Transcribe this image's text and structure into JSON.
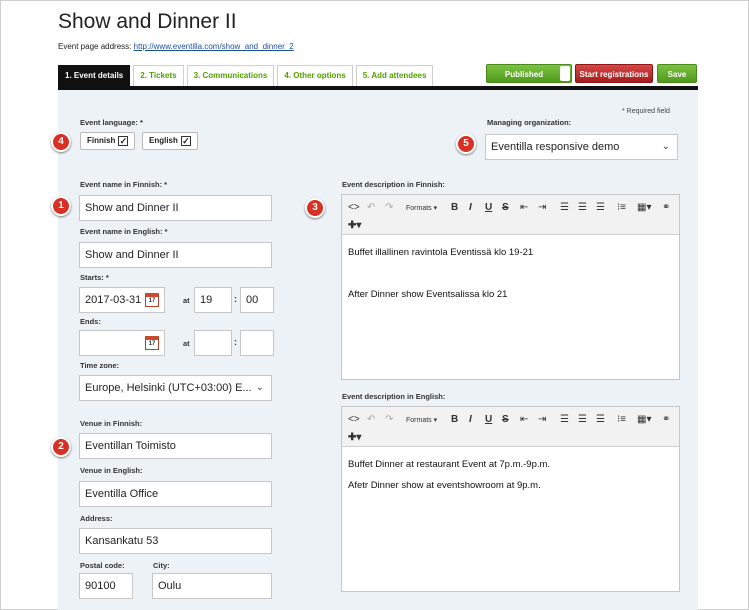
{
  "page": {
    "title": "Show and Dinner II",
    "address_label": "Event page address:",
    "address_url": "http://www.eventilla.com/show_and_dinner_2"
  },
  "tabs": [
    "1. Event details",
    "2. Tickets",
    "3. Communications",
    "4. Other options",
    "5. Add attendees"
  ],
  "actions": {
    "published": "Published",
    "start_registrations": "Start registrations",
    "save": "Save"
  },
  "required_note": "* Required field",
  "language": {
    "label": "Event language: *",
    "options": [
      {
        "label": "Finnish",
        "checked": true
      },
      {
        "label": "English",
        "checked": true
      }
    ]
  },
  "organization": {
    "label": "Managing organization:",
    "value": "Eventilla responsive demo"
  },
  "name_fi": {
    "label": "Event name in Finnish: *",
    "value": "Show and Dinner II"
  },
  "name_en": {
    "label": "Event name in English: *",
    "value": "Show and Dinner II"
  },
  "starts": {
    "label": "Starts: *",
    "date": "2017-03-31",
    "hour": "19",
    "minute": "00",
    "at": "at"
  },
  "ends": {
    "label": "Ends:",
    "date": "",
    "hour": "",
    "minute": "",
    "at": "at"
  },
  "timezone": {
    "label": "Time zone:",
    "value": "Europe, Helsinki (UTC+03:00) E..."
  },
  "venue_fi": {
    "label": "Venue in Finnish:",
    "value": "Eventillan Toimisto"
  },
  "venue_en": {
    "label": "Venue in English:",
    "value": "Eventilla Office"
  },
  "address": {
    "label": "Address:",
    "value": "Kansankatu 53"
  },
  "postal": {
    "label": "Postal code:",
    "value": "90100"
  },
  "city": {
    "label": "City:",
    "value": "Oulu"
  },
  "desc_fi": {
    "label": "Event description in Finnish:",
    "lines": [
      "Buffet illallinen ravintola Eventissä klo 19-21",
      "After Dinner show Eventsalissa klo 21"
    ]
  },
  "desc_en": {
    "label": "Event description in English:",
    "lines": [
      "Buffet Dinner at restaurant Event at 7p.m.-9p.m.",
      "Afetr Dinner show at eventshowroom at 9p.m."
    ]
  },
  "toolbar": {
    "formats": "Formats"
  },
  "badges": [
    "1",
    "2",
    "3",
    "4",
    "5"
  ],
  "colors": {
    "accent_green": "#55a000",
    "publish_green": "#6ab232",
    "registration_red": "#c42a2a",
    "badge_red": "#d93025"
  },
  "icons": [
    "calendar-icon",
    "chevron-down-icon",
    "check-icon",
    "source-code-icon",
    "undo-icon",
    "redo-icon",
    "bold-icon",
    "italic-icon",
    "underline-icon",
    "strikethrough-icon",
    "outdent-icon",
    "indent-icon",
    "align-left-icon",
    "align-center-icon",
    "align-justify-icon",
    "bullet-list-icon",
    "table-icon",
    "link-icon",
    "insert-plus-icon"
  ]
}
